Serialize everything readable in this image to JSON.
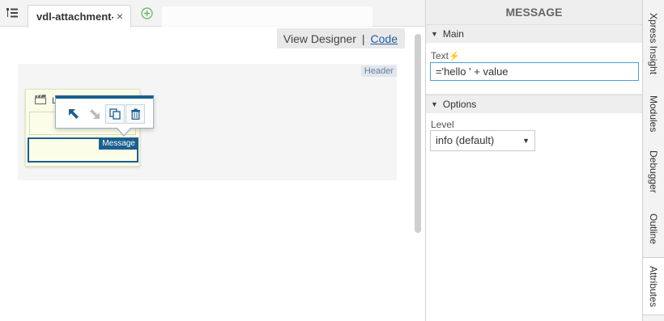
{
  "tabbar": {
    "tab_label": "vdl-attachment-",
    "close_glyph": "×"
  },
  "view_toggle": {
    "designer_label": "View Designer",
    "separator": "|",
    "code_label": "Code"
  },
  "canvas": {
    "header_badge": "Header",
    "action_title": "L",
    "message_tag": "Message"
  },
  "panel": {
    "title": "MESSAGE",
    "main_section": "Main",
    "text_label": "Text",
    "text_value": "='hello ' + value",
    "options_section": "Options",
    "level_label": "Level",
    "level_value": "info (default)"
  },
  "side_tabs": [
    {
      "label": "Xpress Insight"
    },
    {
      "label": "Modules"
    },
    {
      "label": "Debugger"
    },
    {
      "label": "Outline"
    },
    {
      "label": "Attributes"
    }
  ],
  "icons": {
    "menu": "tree-menu-icon",
    "add_tab": "plus-circle-icon",
    "clapper": "clapperboard-icon",
    "move_up_left": "arrow-up-left-icon",
    "move_down_right": "arrow-down-right-icon",
    "copy": "copy-icon",
    "delete": "trash-icon",
    "bolt": "lightning-bolt-icon"
  },
  "colors": {
    "accent": "#1b5f8f",
    "link": "#1f5fa8",
    "bolt": "#f0a000",
    "input_focus": "#4a9fd1"
  }
}
